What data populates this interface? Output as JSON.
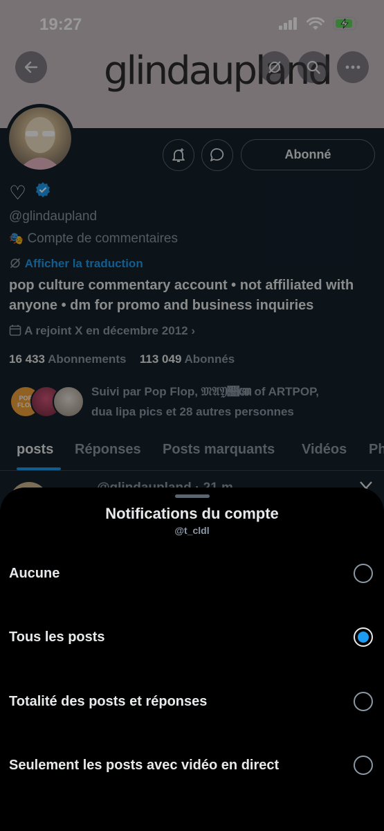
{
  "status": {
    "time": "19:27"
  },
  "profile": {
    "banner_text": "glindaupland",
    "name_heart": "♡",
    "handle": "@glindaupland",
    "category": "Compte de commentaires",
    "translate_link": "Afficher la traduction",
    "bio": "pop culture commentary account • not affiliated with anyone • dm for promo and business inquiries",
    "joined": "A rejoint X en décembre 2012",
    "following_count": "16 433",
    "following_label": "Abonnements",
    "followers_count": "113 049",
    "followers_label": "Abonnés",
    "followed_by": "Suivi par Pop Flop, 𝔐𝔄𝔜𝔋𝔈𝔐 of ARTPOP,",
    "followed_by_2": "dua lipa pics et 28 autres personnes",
    "follow_button": "Abonné",
    "post_preview_handle": "@glindaupland · 21 m",
    "popflop_text": "POP FLOP"
  },
  "tabs": [
    "posts",
    "Réponses",
    "Posts marquants",
    "Vidéos",
    "Ph"
  ],
  "sheet": {
    "title": "Notifications du compte",
    "subtitle": "@t_cldl",
    "options": [
      {
        "label": "Aucune",
        "selected": false
      },
      {
        "label": "Tous les posts",
        "selected": true
      },
      {
        "label": "Totalité des posts et réponses",
        "selected": false
      },
      {
        "label": "Seulement les posts avec vidéo en direct",
        "selected": false
      }
    ]
  },
  "colors": {
    "accent": "#1d9bf0",
    "sheet_bg": "#000000",
    "page_bg": "#15202b"
  }
}
